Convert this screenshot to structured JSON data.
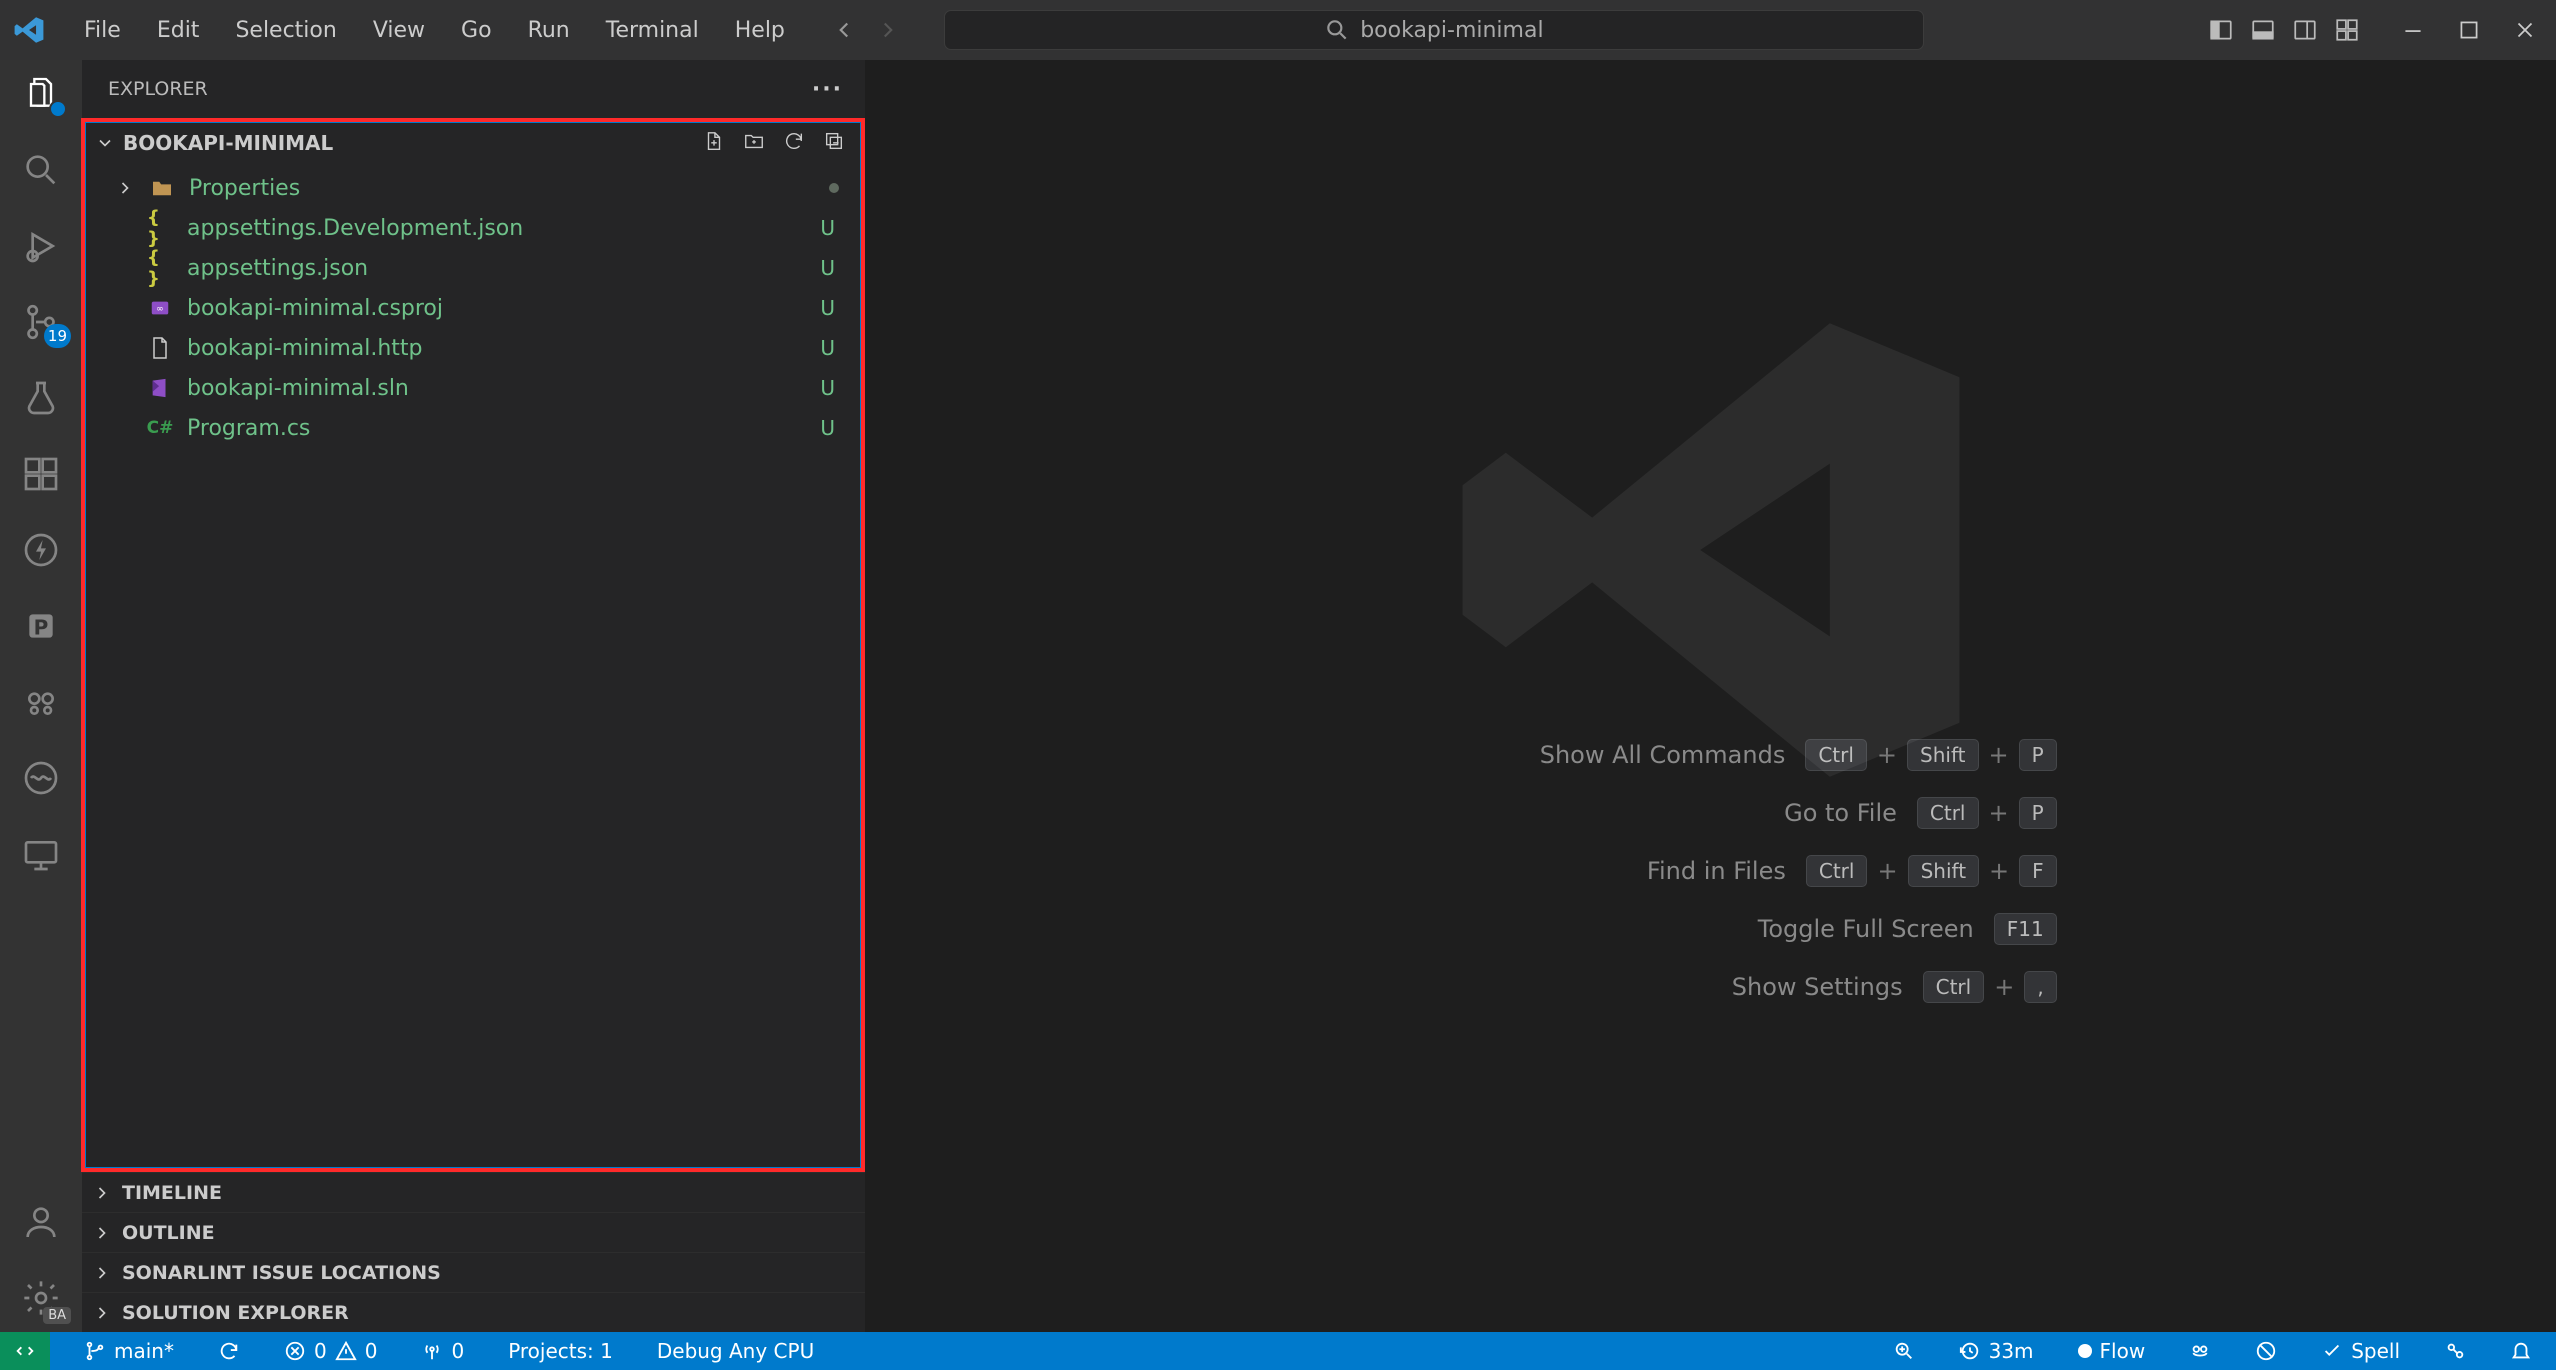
{
  "menu": {
    "file": "File",
    "edit": "Edit",
    "selection": "Selection",
    "view": "View",
    "go": "Go",
    "run": "Run",
    "terminal": "Terminal",
    "help": "Help"
  },
  "search": {
    "text": "bookapi-minimal"
  },
  "sidebar": {
    "title": "EXPLORER",
    "folder": "BOOKAPI-MINIMAL",
    "tree": [
      {
        "name": "Properties",
        "kind": "folder",
        "status": "dot"
      },
      {
        "name": "appsettings.Development.json",
        "kind": "json",
        "status": "U"
      },
      {
        "name": "appsettings.json",
        "kind": "json",
        "status": "U"
      },
      {
        "name": "bookapi-minimal.csproj",
        "kind": "csproj",
        "status": "U"
      },
      {
        "name": "bookapi-minimal.http",
        "kind": "http",
        "status": "U"
      },
      {
        "name": "bookapi-minimal.sln",
        "kind": "sln",
        "status": "U"
      },
      {
        "name": "Program.cs",
        "kind": "cs",
        "status": "U"
      }
    ],
    "panels": {
      "timeline": "TIMELINE",
      "outline": "OUTLINE",
      "sonarlint": "SONARLINT ISSUE LOCATIONS",
      "solution": "SOLUTION EXPLORER"
    }
  },
  "activity": {
    "scm_badge": "19",
    "settings_badge": "BA"
  },
  "welcome": {
    "shortcuts": [
      {
        "label": "Show All Commands",
        "keys": [
          "Ctrl",
          "Shift",
          "P"
        ]
      },
      {
        "label": "Go to File",
        "keys": [
          "Ctrl",
          "P"
        ]
      },
      {
        "label": "Find in Files",
        "keys": [
          "Ctrl",
          "Shift",
          "F"
        ]
      },
      {
        "label": "Toggle Full Screen",
        "keys": [
          "F11"
        ]
      },
      {
        "label": "Show Settings",
        "keys": [
          "Ctrl",
          ","
        ]
      }
    ]
  },
  "status": {
    "branch": "main*",
    "errors": "0",
    "warnings": "0",
    "ports": "0",
    "projects": "Projects: 1",
    "debug": "Debug Any CPU",
    "wakatime": "33m",
    "flow": "Flow",
    "spell": "Spell"
  }
}
